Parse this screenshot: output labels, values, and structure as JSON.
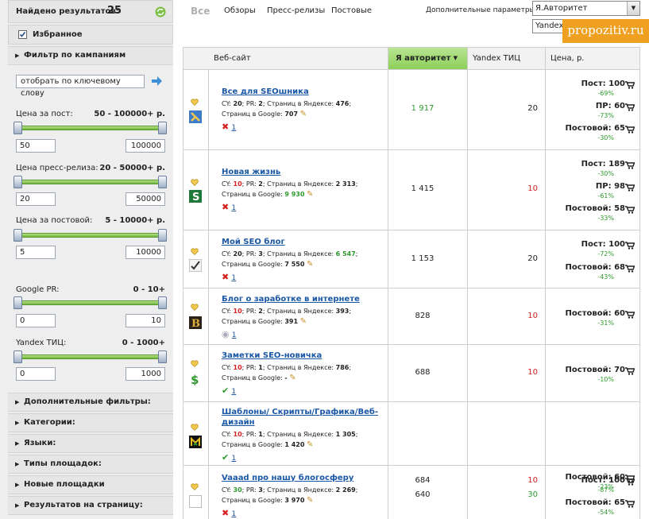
{
  "sidebar": {
    "found_label": "Найдено результатов:",
    "found_count": "25",
    "favorites_label": "Избранное",
    "campaign_filter": "Фильтр по кампаниям",
    "keyword_placeholder": "отобрать по ключевому слову",
    "filters": [
      {
        "label": "Цена за пост:",
        "range": "50 - 100000+ р.",
        "min": "50",
        "max": "100000"
      },
      {
        "label": "Цена пресс-релиза:",
        "range": "20 - 50000+ р.",
        "min": "20",
        "max": "50000"
      },
      {
        "label": "Цена за постовой:",
        "range": "5 - 10000+ р.",
        "min": "5",
        "max": "10000"
      },
      {
        "label": "Google PR:",
        "range": "0 - 10+",
        "min": "0",
        "max": "10"
      },
      {
        "label": "Yandex ТИЦ:",
        "range": "0 - 1000+",
        "min": "0",
        "max": "1000"
      }
    ],
    "sections": [
      "Дополнительные фильтры:",
      "Категории:",
      "Языки:",
      "Типы площадок:",
      "Новые площадки",
      "Результатов на страницу:"
    ]
  },
  "tabs": [
    "Все",
    "Обзоры",
    "Пресс-релизы",
    "Постовые"
  ],
  "params": {
    "label": "Дополнительные параметры:",
    "select_value": "Я.Авторитет",
    "second_value": "Yandex"
  },
  "watermark": "propozitiv.ru",
  "table": {
    "headers": {
      "site": "Веб-сайт",
      "authority": "Я авторитет",
      "tic": "Yandex ТИЦ",
      "price": "Цена, р."
    },
    "rows": [
      {
        "name": "Все для SEOшника",
        "cy": "20",
        "pr": "2",
        "yandex": "476",
        "google": "707",
        "authority": "1 917",
        "tic": "20",
        "link": "1",
        "prices": [
          {
            "label": "Пост:",
            "value": "100",
            "pct": "-69%"
          },
          {
            "label": "ПР:",
            "value": "60",
            "pct": "-73%"
          },
          {
            "label": "Постовой:",
            "value": "65",
            "pct": "-30%"
          }
        ]
      },
      {
        "name": "Новая жизнь",
        "cy": "10",
        "pr": "2",
        "yandex": "2 313",
        "google": "9 930",
        "authority": "1 415",
        "tic": "10",
        "link": "1",
        "prices": [
          {
            "label": "Пост:",
            "value": "189",
            "pct": "-30%"
          },
          {
            "label": "ПР:",
            "value": "98",
            "pct": "-61%"
          },
          {
            "label": "Постовой:",
            "value": "58",
            "pct": "-33%"
          }
        ]
      },
      {
        "name": "Мой SEO блог",
        "cy": "20",
        "pr": "3",
        "yandex": "6 547",
        "google": "7 550",
        "authority": "1 153",
        "tic": "20",
        "link": "1",
        "prices": [
          {
            "label": "Пост:",
            "value": "100",
            "pct": "-72%"
          },
          {
            "label": "Постовой:",
            "value": "68",
            "pct": "-43%"
          }
        ]
      },
      {
        "name": "Блог о заработке в интернете",
        "cy": "10",
        "pr": "2",
        "yandex": "393",
        "google": "391",
        "authority": "828",
        "tic": "10",
        "link": "1",
        "prices": [
          {
            "label": "Постовой:",
            "value": "60",
            "pct": "-31%"
          }
        ]
      },
      {
        "name": "Заметки SEO-новичка",
        "cy": "10",
        "pr": "1",
        "yandex": "786",
        "google": "-",
        "authority": "688",
        "tic": "10",
        "link": "1",
        "prices": [
          {
            "label": "Постовой:",
            "value": "70",
            "pct": "-10%"
          }
        ]
      },
      {
        "name_1": "Шаблоны/ Скрипты/Графика/Веб-",
        "name_2": "дизайн",
        "cy": "10",
        "pr": "1",
        "yandex": "1 305",
        "google": "1 420",
        "authority": "684",
        "tic": "10",
        "link": "1",
        "prices": [
          {
            "label": "Постовой:",
            "value": "60",
            "pct": "-23%"
          }
        ]
      },
      {
        "name": "Vaaad про нашу блогосферу",
        "cy": "30",
        "pr": "3",
        "yandex": "2 269",
        "google": "3 970",
        "authority": "640",
        "tic": "30",
        "link": "1",
        "prices": [
          {
            "label": "Пост:",
            "value": "100",
            "pct": "-87%"
          },
          {
            "label": "Постовой:",
            "value": "65",
            "pct": "-54%"
          }
        ]
      }
    ],
    "meta_labels": {
      "cy": "CY:",
      "pr": "PR:",
      "yandex": "Страниц в Яндексе:",
      "google": "Страниц в Google:"
    }
  },
  "colors": {
    "accent_green": "#6db43a",
    "header_active": "#9dd36b",
    "link_blue": "#1a57a5",
    "watermark_orange": "#f0a020"
  }
}
